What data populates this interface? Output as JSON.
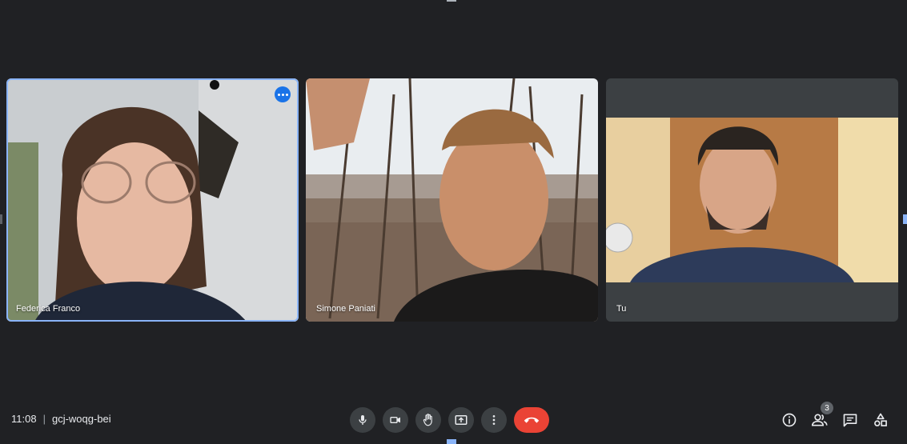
{
  "meeting": {
    "time": "11:08",
    "separator": "|",
    "code": "gcj-woqg-bei"
  },
  "participants": [
    {
      "name": "Federica Franco",
      "active_speaker": true
    },
    {
      "name": "Simone Paniati",
      "active_speaker": false
    },
    {
      "name": "Tu",
      "is_self": true
    }
  ],
  "controls": [
    {
      "id": "microphone",
      "icon": "microphone-icon"
    },
    {
      "id": "camera",
      "icon": "camera-icon"
    },
    {
      "id": "raise-hand",
      "icon": "hand-icon"
    },
    {
      "id": "present",
      "icon": "present-screen-icon"
    },
    {
      "id": "more-options",
      "icon": "more-vert-icon"
    },
    {
      "id": "leave-call",
      "icon": "end-call-icon"
    }
  ],
  "side_panel": {
    "people_count": "3",
    "icons": [
      "info-icon",
      "people-icon",
      "chat-icon",
      "activities-icon"
    ]
  },
  "colors": {
    "background": "#202124",
    "tile": "#3c4043",
    "accent": "#8ab4f8",
    "active_border": "#8ab4f8",
    "more_button": "#1a73e8",
    "end_call": "#ea4335"
  }
}
